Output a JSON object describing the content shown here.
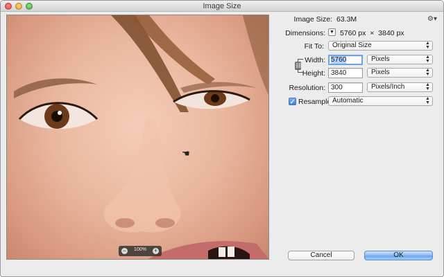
{
  "window": {
    "title": "Image Size"
  },
  "preview": {
    "zoom_level": "100%",
    "zoom_out_glyph": "−",
    "zoom_in_glyph": "+",
    "cursor_icon": "hand-icon"
  },
  "info": {
    "image_size_label": "Image Size:",
    "image_size_value": "63.3M",
    "dimensions_label": "Dimensions:",
    "dimensions_value": "5760 px  ×  3840 px"
  },
  "fit_to": {
    "label": "Fit To:",
    "value": "Original Size"
  },
  "width": {
    "label": "Width:",
    "value": "5760",
    "unit": "Pixels"
  },
  "height": {
    "label": "Height:",
    "value": "3840",
    "unit": "Pixels"
  },
  "resolution": {
    "label": "Resolution:",
    "value": "300",
    "unit": "Pixels/Inch"
  },
  "resample": {
    "label": "Resample:",
    "checked": true,
    "value": "Automatic"
  },
  "buttons": {
    "cancel": "Cancel",
    "ok": "OK"
  },
  "colors": {
    "accent": "#6ea4ec",
    "focus_ring": "#6aa3e8",
    "selection": "#b3d3fb"
  }
}
